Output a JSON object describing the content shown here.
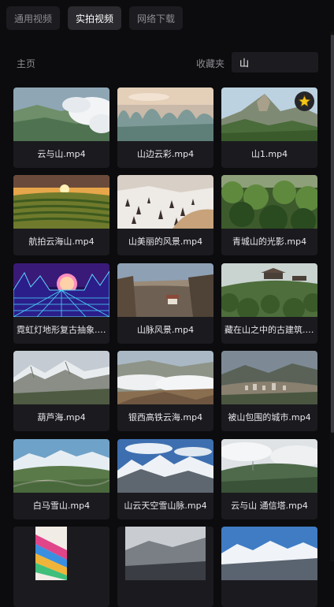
{
  "tabs": [
    {
      "label": "通用视频",
      "active": false
    },
    {
      "label": "实拍视频",
      "active": true
    },
    {
      "label": "网络下载",
      "active": false
    }
  ],
  "header": {
    "breadcrumb": "主页",
    "favorites_label": "收藏夹",
    "search_value": "山"
  },
  "videos": [
    {
      "title": "云与山.mp4",
      "favorite": false,
      "thumb": "cloud-valley"
    },
    {
      "title": "山边云彩.mp4",
      "favorite": false,
      "thumb": "karst-dawn"
    },
    {
      "title": "山1.mp4",
      "favorite": true,
      "thumb": "green-peak"
    },
    {
      "title": "航拍云海山.mp4",
      "favorite": false,
      "thumb": "sunset-terraces"
    },
    {
      "title": "山美丽的风景.mp4",
      "favorite": false,
      "thumb": "snow-forest"
    },
    {
      "title": "青城山的光影.mp4",
      "favorite": false,
      "thumb": "green-forest"
    },
    {
      "title": "霓虹灯地形复古抽象.mp4",
      "favorite": false,
      "thumb": "neon-retro"
    },
    {
      "title": "山脉风景.mp4",
      "favorite": false,
      "thumb": "canyon"
    },
    {
      "title": "藏在山之中的古建筑.mp4",
      "favorite": false,
      "thumb": "hill-temple"
    },
    {
      "title": "葫芦海.mp4",
      "favorite": false,
      "thumb": "snow-ridge"
    },
    {
      "title": "银西高铁云海.mp4",
      "favorite": false,
      "thumb": "cloud-sea"
    },
    {
      "title": "被山包围的城市.mp4",
      "favorite": false,
      "thumb": "city-mountains"
    },
    {
      "title": "白马雪山.mp4",
      "favorite": false,
      "thumb": "white-horse"
    },
    {
      "title": "山云天空雪山脉.mp4",
      "favorite": false,
      "thumb": "snow-range"
    },
    {
      "title": "云与山 通信塔.mp4",
      "favorite": false,
      "thumb": "cloud-tower"
    },
    {
      "title": "",
      "favorite": false,
      "thumb": "colorful"
    },
    {
      "title": "",
      "favorite": false,
      "thumb": "dark-mountain"
    },
    {
      "title": "",
      "favorite": false,
      "thumb": "snow-cap"
    }
  ],
  "colors": {
    "background": "#0c0c0e",
    "card": "#1b1b1f",
    "tab_active": "#2a2a2f",
    "star": "#f5c518"
  }
}
